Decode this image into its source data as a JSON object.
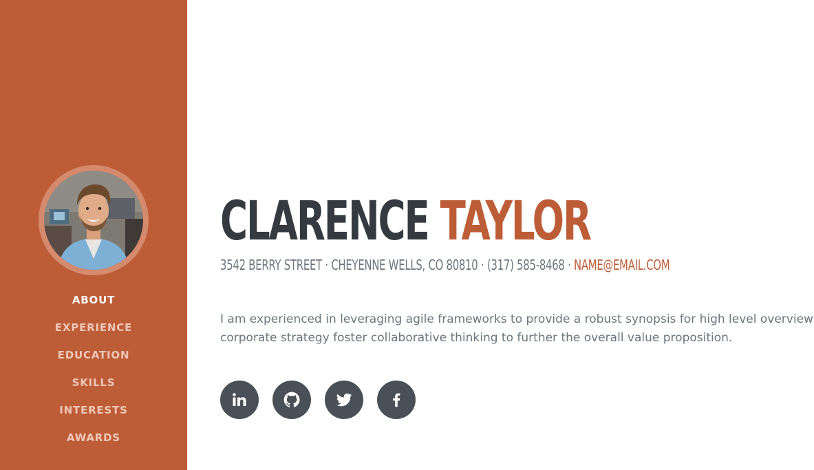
{
  "profile": {
    "first_name": "CLARENCE",
    "last_name": "TAYLOR",
    "address": "3542 BERRY STREET · CHEYENNE WELLS, CO 80810 · (317) 585-8468 · ",
    "email": "NAME@EMAIL.COM",
    "bio_line_1": "I am experienced in leveraging agile frameworks to provide a robust synopsis for high level overviews. Iterative approaches to",
    "bio_line_2": "corporate strategy foster collaborative thinking to further the overall value proposition."
  },
  "nav": {
    "items": [
      {
        "label": "ABOUT",
        "active": true
      },
      {
        "label": "EXPERIENCE",
        "active": false
      },
      {
        "label": "EDUCATION",
        "active": false
      },
      {
        "label": "SKILLS",
        "active": false
      },
      {
        "label": "INTERESTS",
        "active": false
      },
      {
        "label": "AWARDS",
        "active": false
      }
    ]
  },
  "social": [
    {
      "icon": "linkedin-icon"
    },
    {
      "icon": "github-icon"
    },
    {
      "icon": "twitter-icon"
    },
    {
      "icon": "facebook-icon"
    }
  ],
  "colors": {
    "primary": "#bd5d38",
    "dark": "#343a40",
    "muted": "#6c757d",
    "social_bg": "#495057"
  }
}
